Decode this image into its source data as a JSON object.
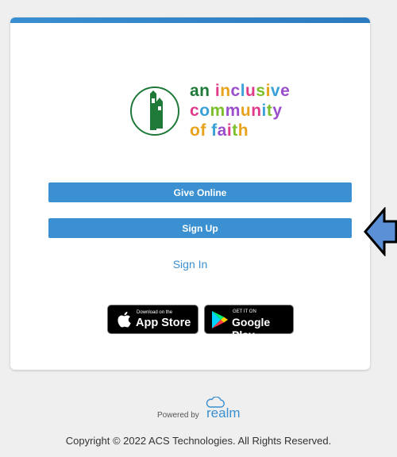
{
  "logo": {
    "lines": [
      [
        {
          "t": "an ",
          "c": "#1f7a3a"
        },
        {
          "t": "i",
          "c": "#e03b8a"
        },
        {
          "t": "n",
          "c": "#e8a21b"
        },
        {
          "t": "c",
          "c": "#9a4ecb"
        },
        {
          "t": "l",
          "c": "#3aa1d8"
        },
        {
          "t": "u",
          "c": "#e03b8a"
        },
        {
          "t": "s",
          "c": "#7bbf2a"
        },
        {
          "t": "i",
          "c": "#e8a21b"
        },
        {
          "t": "v",
          "c": "#3aa1d8"
        },
        {
          "t": "e",
          "c": "#9a4ecb"
        }
      ],
      [
        {
          "t": "c",
          "c": "#e03b8a"
        },
        {
          "t": "o",
          "c": "#3aa1d8"
        },
        {
          "t": "m",
          "c": "#7bbf2a"
        },
        {
          "t": "m",
          "c": "#9a4ecb"
        },
        {
          "t": "u",
          "c": "#e8a21b"
        },
        {
          "t": "n",
          "c": "#e03b8a"
        },
        {
          "t": "i",
          "c": "#3aa1d8"
        },
        {
          "t": "t",
          "c": "#7bbf2a"
        },
        {
          "t": "y",
          "c": "#9a4ecb"
        }
      ],
      [
        {
          "t": "of ",
          "c": "#e8a21b"
        },
        {
          "t": "f",
          "c": "#3aa1d8"
        },
        {
          "t": "a",
          "c": "#9a4ecb"
        },
        {
          "t": "i",
          "c": "#e03b8a"
        },
        {
          "t": "t",
          "c": "#7bbf2a"
        },
        {
          "t": "h",
          "c": "#e8a21b"
        }
      ]
    ]
  },
  "buttons": {
    "give_online": "Give Online",
    "sign_up": "Sign Up",
    "sign_in": "Sign In"
  },
  "badges": {
    "appstore_small": "Download on the",
    "appstore_big": "App Store",
    "google_small": "GET IT ON",
    "google_big": "Google Play"
  },
  "footer": {
    "powered_label": "Powered by",
    "powered_brand": "realm",
    "copyright": "Copyright © 2022 ACS Technologies. All Rights Reserved."
  },
  "colors": {
    "accent": "#3a90d0",
    "arrow_fill": "#5b8fd6"
  }
}
